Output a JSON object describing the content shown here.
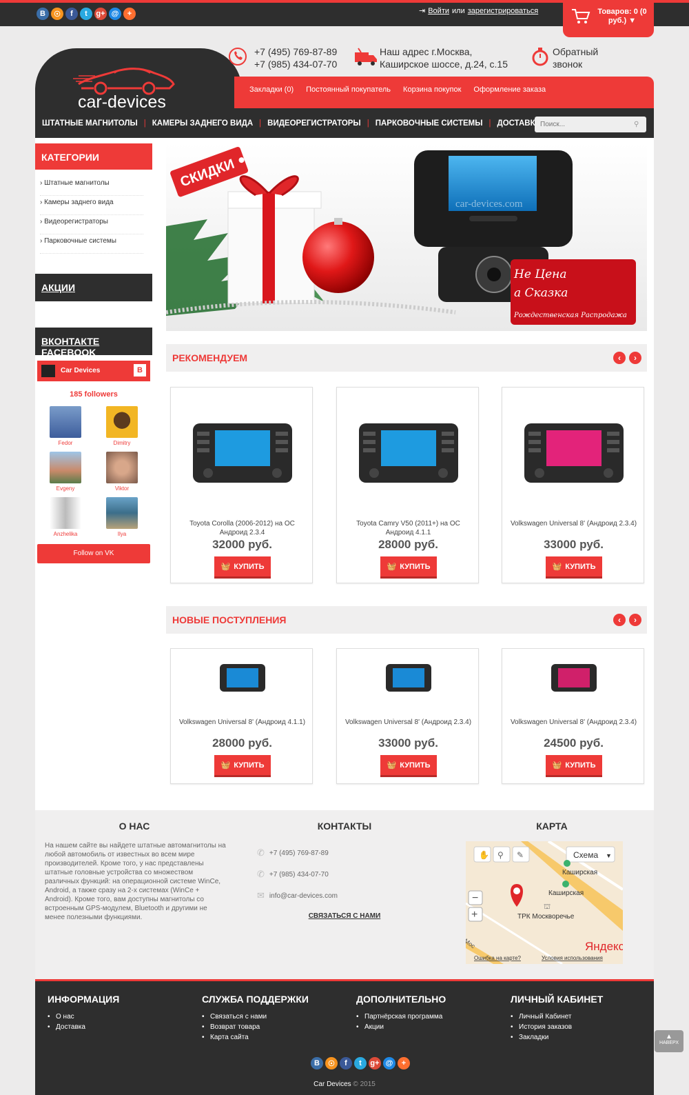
{
  "topbar": {
    "social": [
      {
        "icon": "vk-icon",
        "glyph": "B",
        "color": "#3b6ea8"
      },
      {
        "icon": "odnoklassniki-icon",
        "glyph": "☉",
        "color": "#f7931e"
      },
      {
        "icon": "facebook-icon",
        "glyph": "f",
        "color": "#3b5998"
      },
      {
        "icon": "twitter-icon",
        "glyph": "t",
        "color": "#2aa9e0"
      },
      {
        "icon": "google-plus-icon",
        "glyph": "g+",
        "color": "#dd4b39"
      },
      {
        "icon": "mail-icon",
        "glyph": "@",
        "color": "#1e88e5"
      },
      {
        "icon": "plus-icon",
        "glyph": "+",
        "color": "#ff6f30"
      }
    ],
    "login": "Войти",
    "or": "или",
    "register": "зарегистрироваться",
    "cart_line1": "Товаров: 0 (0",
    "cart_line2": "руб.)"
  },
  "header": {
    "logo": "car-devices",
    "phone1": "+7 (495) 769-87-89",
    "phone2": "+7 (985) 434-07-70",
    "address1": "Наш адрес г.Москва,",
    "address2": "Каширское шоссе, д.24, с.15",
    "callback1": "Обратный",
    "callback2": "звонок",
    "redmenu": [
      "Закладки (0)",
      "Постоянный покупатель",
      "Корзина покупок",
      "Оформление заказа"
    ],
    "mainnav": [
      "ШТАТНЫЕ МАГНИТОЛЫ",
      "КАМЕРЫ ЗАДНЕГО ВИДА",
      "ВИДЕОРЕГИСТРАТОРЫ",
      "ПАРКОВОЧНЫЕ СИСТЕМЫ",
      "ДОСТАВКА"
    ],
    "search_placeholder": "Поиск..."
  },
  "sidebar": {
    "categories_title": "КАТЕГОРИИ",
    "categories": [
      "Штатные магнитолы",
      "Камеры заднего вида",
      "Видеорегистраторы",
      "Парковочные системы"
    ],
    "promo_title": "АКЦИИ",
    "social_title_vk": "ВКОНТАКТЕ",
    "social_title_fb": "FACEBOOK",
    "vk_group": "Car Devices",
    "followers": "185 followers",
    "members": [
      "Fedor",
      "Dimitry",
      "Evgeny",
      "Viktor",
      "Anzhelika",
      "Ilya"
    ],
    "follow_btn": "Follow on VK"
  },
  "banner": {
    "tag": "СКИДКИ",
    "watermark": "car-devices.com",
    "card1": "Не Цена",
    "card2": "а Сказка",
    "card3": "Рождественская Распродажа"
  },
  "recommended": {
    "title": "РЕКОМЕНДУЕМ",
    "items": [
      {
        "name": "Toyota Corolla (2006-2012) на ОС Андроид 2.3.4",
        "price": "32000 руб.",
        "buy": "КУПИТЬ"
      },
      {
        "name": "Toyota Camry V50 (2011+) на ОС Андроид 4.1.1",
        "price": "28000 руб.",
        "buy": "КУПИТЬ"
      },
      {
        "name": "Volkswagen Universal 8' (Андроид 2.3.4)",
        "price": "33000 руб.",
        "buy": "КУПИТЬ"
      }
    ]
  },
  "newitems": {
    "title": "НОВЫЕ ПОСТУПЛЕНИЯ",
    "items": [
      {
        "name": "Volkswagen Universal 8' (Андроид 4.1.1)",
        "price": "28000 руб.",
        "buy": "КУПИТЬ"
      },
      {
        "name": "Volkswagen Universal 8' (Андроид 2.3.4)",
        "price": "33000 руб.",
        "buy": "КУПИТЬ"
      },
      {
        "name": "Volkswagen Universal 8' (Андроид 2.3.4)",
        "price": "24500 руб.",
        "buy": "КУПИТЬ"
      }
    ]
  },
  "footer": {
    "about_title": "О НАС",
    "about_text": "На нашем сайте вы найдете штатные автомагнитолы на любой автомобиль от известных во всем мире производителей. Кроме того, у нас представлены штатные головные устройства со множеством различных функций: на операционной системе WinCe, Android, а также сразу на 2-х системах (WinCe + Android). Кроме того, вам доступны магнитолы со встроенным GPS-модулем, Bluetooth и другими не менее полезными функциями.",
    "contacts_title": "КОНТАКТЫ",
    "phone1": "+7 (495) 769-87-89",
    "phone2": "+7 (985) 434-07-70",
    "email": "info@car-devices.com",
    "contact_us": "СВЯЗАТЬСЯ С НАМИ",
    "map_title": "КАРТА",
    "map_scheme": "Схема",
    "map_metro1": "Каширская",
    "map_metro2": "Каширская",
    "map_place": "ТРК Москворечье",
    "map_brand": "Яндекс",
    "map_error": "Ошибка на карте?",
    "map_terms": "Условия использования",
    "map_street": "Мос",
    "cols": [
      {
        "title": "ИНФОРМАЦИЯ",
        "items": [
          "О нас",
          "Доставка"
        ]
      },
      {
        "title": "СЛУЖБА ПОДДЕРЖКИ",
        "items": [
          "Связаться с нами",
          "Возврат товара",
          "Карта сайта"
        ]
      },
      {
        "title": "ДОПОЛНИТЕЛЬНО",
        "items": [
          "Партнёрская программа",
          "Акции"
        ]
      },
      {
        "title": "ЛИЧНЫЙ КАБИНЕТ",
        "items": [
          "Личный Кабинет",
          "История заказов",
          "Закладки"
        ]
      }
    ],
    "copyright_name": "Car Devices",
    "copyright_year": "© 2015",
    "to_top": "НАВЕРХ"
  }
}
